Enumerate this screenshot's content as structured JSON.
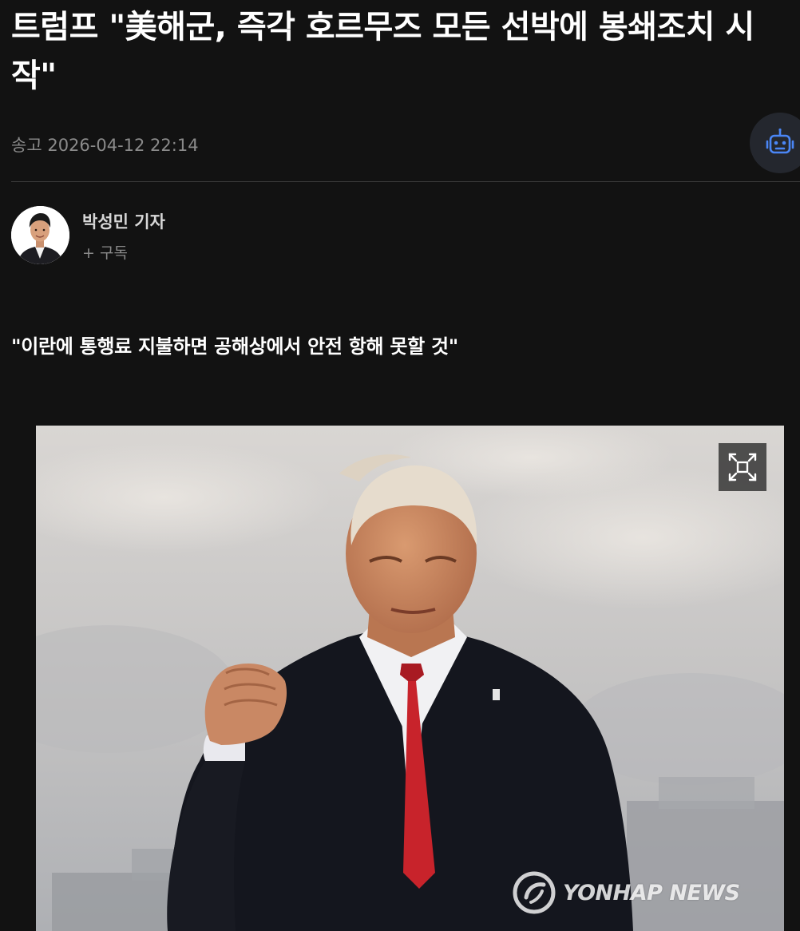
{
  "article": {
    "headline": "트럼프 \"美해군, 즉각 호르무즈 모든 선박에 봉쇄조치 시작\"",
    "published_label": "송고",
    "published_datetime": "2026-04-12 22:14",
    "subtitle": "\"이란에 통행료 지불하면 공해상에서 안전 항해 못할 것\""
  },
  "byline": {
    "reporter": "박성민 기자",
    "subscribe_label": "+ 구독"
  },
  "photo": {
    "watermark": "YONHAP NEWS",
    "expand_icon": "expand-icon"
  },
  "icons": {
    "ai_assistant": "robot-icon"
  },
  "colors": {
    "background": "#121212",
    "headline": "#ffffff",
    "muted": "#8a8a8a",
    "bot_button_bg": "#24272e",
    "bot_icon": "#4a86f5",
    "tie": "#c8232b"
  }
}
